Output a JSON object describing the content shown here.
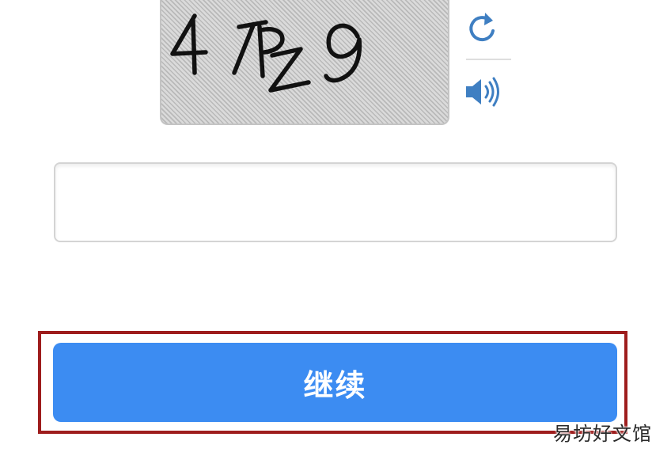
{
  "captcha": {
    "image_text": "4TPZ9"
  },
  "controls": {
    "refresh_icon": "refresh-icon",
    "audio_icon": "speaker-icon"
  },
  "input": {
    "value": "",
    "placeholder": ""
  },
  "button": {
    "continue_label": "继续"
  },
  "watermark": {
    "text": "易坊好文馆"
  },
  "colors": {
    "button_bg": "#3c8cf2",
    "highlight_frame": "#9e1d1d",
    "icon_blue": "#3f7fc2"
  }
}
